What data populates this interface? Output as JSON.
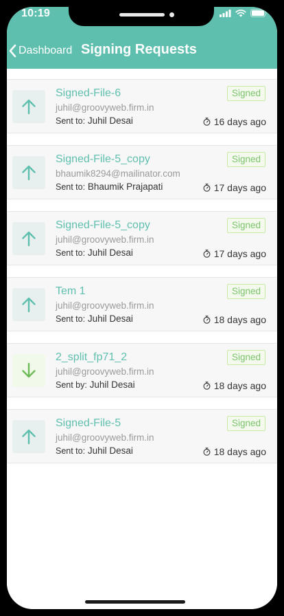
{
  "status_bar": {
    "time": "10:19",
    "icons": [
      "signal-icon",
      "wifi-icon",
      "battery-icon"
    ]
  },
  "nav": {
    "back_label": "Dashboard",
    "title": "Signing Requests"
  },
  "colors": {
    "header": "#5fbfae",
    "title": "#5fbfae",
    "badge_text": "#7cc46b",
    "badge_border": "#c9e7a8"
  },
  "requests": [
    {
      "direction": "up",
      "direction_icon": "arrow-up-icon",
      "title": "Signed-File-6",
      "email": "juhil@groovyweb.firm.in",
      "sent_label": "Sent to:",
      "sent_name": "Juhil Desai",
      "status": "Signed",
      "time": "16 days ago"
    },
    {
      "direction": "up",
      "direction_icon": "arrow-up-icon",
      "title": "Signed-File-5_copy",
      "email": "bhaumik8294@mailinator.com",
      "sent_label": "Sent to:",
      "sent_name": "Bhaumik Prajapati",
      "status": "Signed",
      "time": "17 days ago"
    },
    {
      "direction": "up",
      "direction_icon": "arrow-up-icon",
      "title": "Signed-File-5_copy",
      "email": "juhil@groovyweb.firm.in",
      "sent_label": "Sent to:",
      "sent_name": "Juhil Desai",
      "status": "Signed",
      "time": "17 days ago"
    },
    {
      "direction": "up",
      "direction_icon": "arrow-up-icon",
      "title": "Tem 1",
      "email": "juhil@groovyweb.firm.in",
      "sent_label": "Sent to:",
      "sent_name": "Juhil Desai",
      "status": "Signed",
      "time": "18 days ago"
    },
    {
      "direction": "down",
      "direction_icon": "arrow-down-icon",
      "title": "2_split_fp71_2",
      "email": "juhil@groovyweb.firm.in",
      "sent_label": "Sent by:",
      "sent_name": "Juhil Desai",
      "status": "Signed",
      "time": "18 days ago"
    },
    {
      "direction": "up",
      "direction_icon": "arrow-up-icon",
      "title": "Signed-File-5",
      "email": "juhil@groovyweb.firm.in",
      "sent_label": "Sent to:",
      "sent_name": "Juhil Desai",
      "status": "Signed",
      "time": "18 days ago"
    }
  ]
}
